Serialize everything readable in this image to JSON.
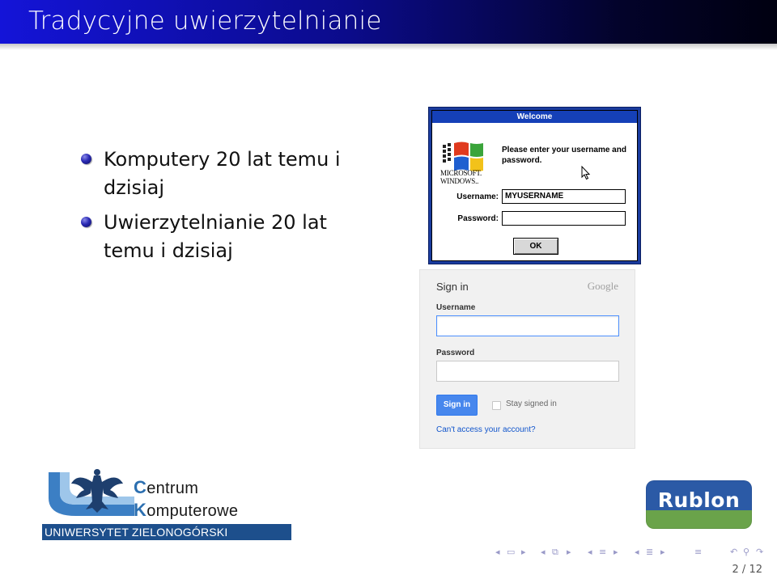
{
  "slide": {
    "title": "Tradycyjne uwierzytelnianie",
    "bullets": [
      "Komputery 20 lat temu i dzisiaj",
      "Uwierzytelnianie 20 lat temu i dzisiaj"
    ],
    "page": "2 / 12"
  },
  "windows_login": {
    "title": "Welcome",
    "brand_line1": "MICROSOFT.",
    "brand_line2": "WINDOWS..",
    "prompt": "Please enter your username and password.",
    "username_label": "Username:",
    "username_value": "MYUSERNAME",
    "password_label": "Password:",
    "password_value": "",
    "ok_label": "OK"
  },
  "google_login": {
    "title": "Sign in",
    "logo": "Google",
    "username_label": "Username",
    "password_label": "Password",
    "signin_label": "Sign in",
    "stay_signed_in": "Stay signed in",
    "help_link": "Can't access your account?"
  },
  "logos": {
    "ck_initial1": "C",
    "ck_rest1": "entrum",
    "ck_initial2": "K",
    "ck_rest2": "omputerowe",
    "ck_university": "UNIWERSYTET ZIELONOGÓRSKI",
    "rublon": "Rublon"
  },
  "colors": {
    "header_start": "#1414d8",
    "header_end": "#000010",
    "bullet": "#2a2ab4",
    "google_button": "#4787ed",
    "rublon_blue": "#2b5aa6",
    "rublon_green": "#6aa34a"
  }
}
